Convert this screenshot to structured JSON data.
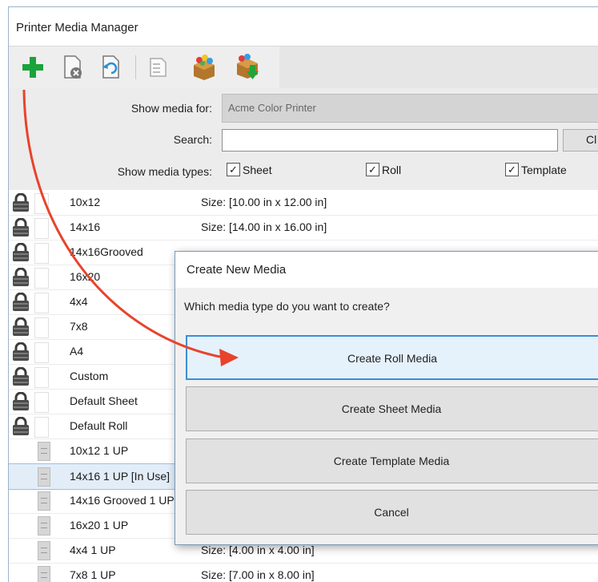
{
  "window": {
    "title": "Printer Media Manager"
  },
  "toolbar": {
    "buttons": [
      {
        "icon": "add-icon"
      },
      {
        "icon": "delete-media-icon"
      },
      {
        "icon": "refresh-media-icon"
      },
      {
        "icon": "properties-icon"
      },
      {
        "icon": "import-package-icon"
      },
      {
        "icon": "export-package-icon"
      }
    ]
  },
  "filters": {
    "show_media_for_label": "Show media for:",
    "show_media_for_value": "Acme Color Printer",
    "search_label": "Search:",
    "search_value": "",
    "clear_label": "Cl",
    "types_label": "Show media types:",
    "types": [
      {
        "label": "Sheet",
        "checked": true
      },
      {
        "label": "Roll",
        "checked": true
      },
      {
        "label": "Template",
        "checked": true
      }
    ]
  },
  "media_list": {
    "rows": [
      {
        "name": "10x12",
        "size": "Size: [10.00 in x 12.00 in]"
      },
      {
        "name": "14x16",
        "size": "Size: [14.00 in x 16.00 in]"
      },
      {
        "name": "14x16Grooved",
        "size": ""
      },
      {
        "name": "16x20",
        "size": ""
      },
      {
        "name": "4x4",
        "size": ""
      },
      {
        "name": "7x8",
        "size": ""
      },
      {
        "name": "A4",
        "size": ""
      },
      {
        "name": "Custom",
        "size": ""
      },
      {
        "name": "Default Sheet",
        "size": ""
      },
      {
        "name": "Default Roll",
        "size": ""
      },
      {
        "name": "10x12 1 UP",
        "size": ""
      },
      {
        "name": "14x16 1 UP [In Use]",
        "size": ""
      },
      {
        "name": "14x16 Grooved 1 UP",
        "size": ""
      },
      {
        "name": "16x20 1 UP",
        "size": ""
      },
      {
        "name": "4x4 1 UP",
        "size": "Size: [4.00 in x 4.00 in]"
      },
      {
        "name": "7x8 1 UP",
        "size": "Size: [7.00 in x 8.00 in]"
      }
    ]
  },
  "dialog": {
    "title": "Create New Media",
    "question": "Which media type do you want to create?",
    "buttons": {
      "roll": "Create Roll Media",
      "sheet": "Create Sheet Media",
      "template": "Create Template Media",
      "cancel": "Cancel"
    }
  },
  "colors": {
    "annotation_arrow": "#e8432b",
    "add_icon": "#1aa33a",
    "focus_border": "#3c8ed6"
  }
}
